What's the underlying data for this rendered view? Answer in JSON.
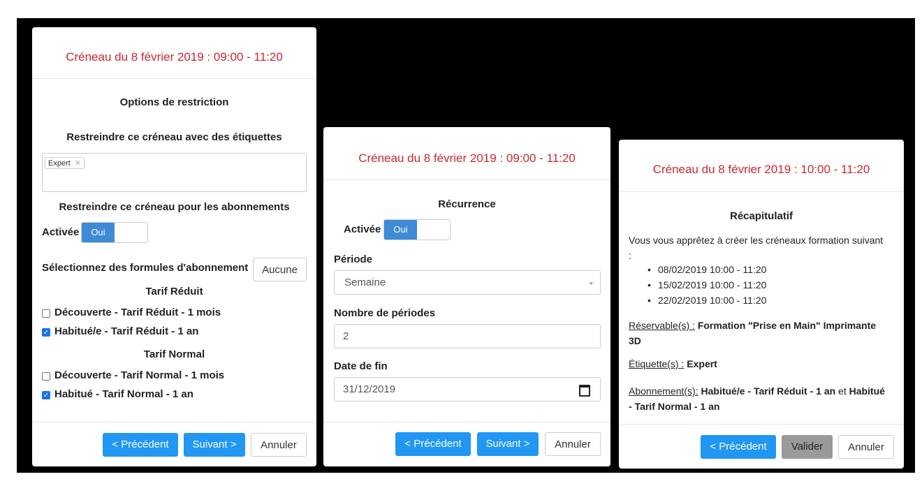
{
  "panel1": {
    "title": "Créneau du 8 février 2019 : 09:00 - 11:20",
    "section_title": "Options de restriction",
    "tags_label": "Restreindre ce créneau avec des étiquettes",
    "tags": [
      "Expert"
    ],
    "subs_label": "Restreindre ce créneau pour les abonnements",
    "activated_label": "Activée",
    "toggle_on_label": "Oui",
    "toggle_value": true,
    "select_label": "Sélectionnez des formules d'abonnement",
    "none_button": "Aucune",
    "groups": [
      {
        "name": "Tarif Réduit",
        "items": [
          {
            "label": "Découverte - Tarif Réduit - 1 mois",
            "checked": false
          },
          {
            "label": "Habitué/e - Tarif Réduit - 1 an",
            "checked": true
          }
        ]
      },
      {
        "name": "Tarif Normal",
        "items": [
          {
            "label": "Découverte - Tarif Normal - 1 mois",
            "checked": false
          },
          {
            "label": "Habitué - Tarif Normal - 1 an",
            "checked": true
          }
        ]
      }
    ],
    "prev_button": "< Précédent",
    "next_button": "Suivant >",
    "cancel_button": "Annuler"
  },
  "panel2": {
    "title": "Créneau du 8 février 2019 : 09:00 - 11:20",
    "section_title": "Récurrence",
    "activated_label": "Activée",
    "toggle_on_label": "Oui",
    "toggle_value": true,
    "period_label": "Période",
    "period_value": "Semaine",
    "count_label": "Nombre de périodes",
    "count_value": "2",
    "end_label": "Date de fin",
    "end_value": "31/12/2019",
    "prev_button": "< Précédent",
    "next_button": "Suivant >",
    "cancel_button": "Annuler"
  },
  "panel3": {
    "title": "Créneau du 8 février 2019 : 10:00 - 11:20",
    "section_title": "Récapitulatif",
    "intro": "Vous vous apprêtez à créer les créneaux formation suivant :",
    "slots": [
      "08/02/2019 10:00 - 11:20",
      "15/02/2019 10:00 - 11:20",
      "22/02/2019 10:00 - 11:20"
    ],
    "reservable_label": "Réservable(s) :",
    "reservable_value": "Formation \"Prise en Main\" Imprimante 3D",
    "tags_label": "Étiquette(s) :",
    "tags_value": "Expert",
    "subs_label": "Abonnement(s):",
    "subs_value_1": "Habitué/e - Tarif Réduit - 1 an",
    "subs_conj": "et",
    "subs_value_2": "Habitué - Tarif Normal - 1 an",
    "prev_button": "< Précédent",
    "validate_button": "Valider",
    "cancel_button": "Annuler"
  },
  "colors": {
    "title": "#c9272f",
    "primary": "#2196f3",
    "toggle": "#3e8ad4",
    "disabled": "#9a9a9a"
  }
}
